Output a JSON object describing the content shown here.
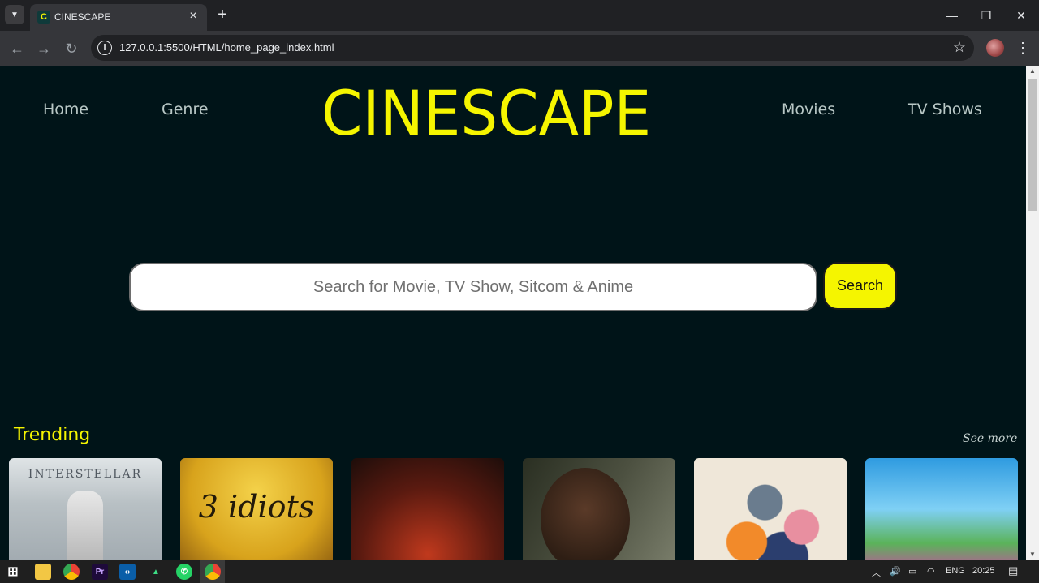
{
  "browser": {
    "tab_title": "CINESCAPE",
    "favicon_letter": "C",
    "url": "127.0.0.1:5500/HTML/home_page_index.html"
  },
  "site": {
    "logo": "CINESCAPE",
    "nav_left": [
      "Home",
      "Genre"
    ],
    "nav_right": [
      "Movies",
      "TV Shows"
    ],
    "search_placeholder": "Search for Movie, TV Show, Sitcom & Anime",
    "search_button": "Search",
    "accent_color": "#f5f500",
    "background_color": "#001418"
  },
  "trending": {
    "title": "Trending",
    "see_more": "See more",
    "posters": [
      {
        "name": "interstellar",
        "text": "INTERSTELLAR"
      },
      {
        "name": "3-idiots",
        "text": "3 idiots"
      },
      {
        "name": "stranger-things",
        "text": ""
      },
      {
        "name": "action-movie",
        "text": ""
      },
      {
        "name": "naruto",
        "text": ""
      },
      {
        "name": "animated-show",
        "text": ""
      }
    ]
  },
  "taskbar": {
    "language": "ENG",
    "time": "20:25",
    "apps": [
      "windows-start-icon",
      "file-explorer-icon",
      "chrome-icon",
      "premiere-pro-icon",
      "vscode-icon",
      "android-studio-icon",
      "whatsapp-icon",
      "chrome-active-icon"
    ]
  }
}
